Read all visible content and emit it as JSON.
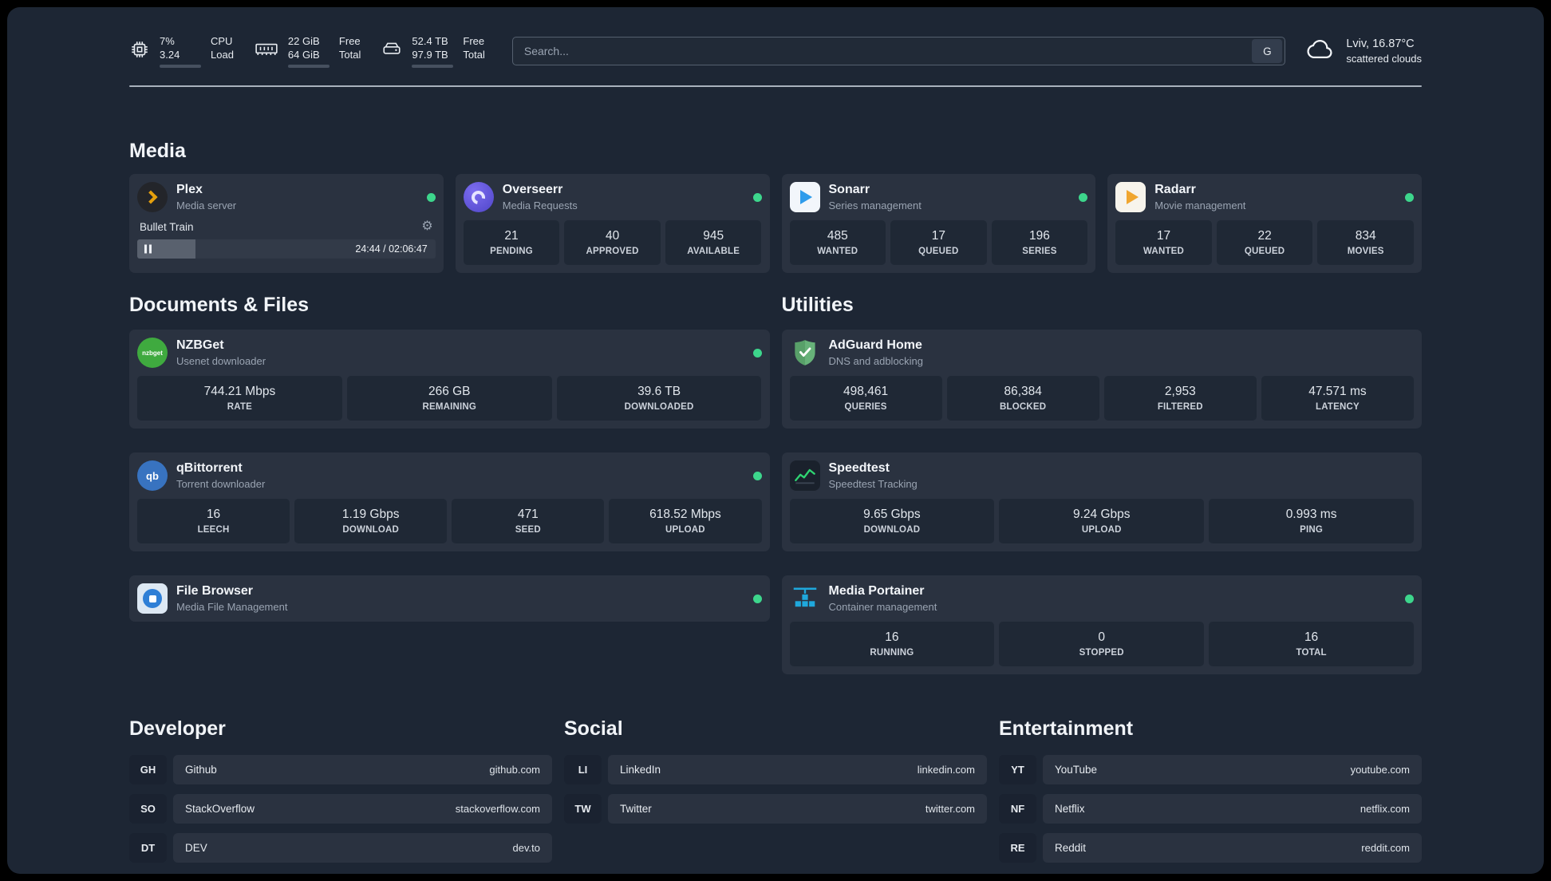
{
  "colors": {
    "panel_bg": "#1d2634",
    "card_bg": "#2a3240",
    "tile_bg": "#1f2835",
    "status_green": "#3dd68c",
    "plex_amber": "#e5a00d",
    "sonarr_blue": "#2f9ceb",
    "radarr_amber": "#f0a62f",
    "adguard_green": "#67b279",
    "portainer_blue": "#1fa8dc",
    "speedtest_green": "#2fd472"
  },
  "topbar": {
    "cpu": {
      "value_line1": "7%",
      "value_line2": "3.24",
      "bar_percent": 7,
      "label_line1": "CPU",
      "label_line2": "Load"
    },
    "memory": {
      "value_line1": "22 GiB",
      "value_line2": "64 GiB",
      "bar_percent": 34,
      "label_line1": "Free",
      "label_line2": "Total"
    },
    "disk": {
      "value_line1": "52.4 TB",
      "value_line2": "97.9 TB",
      "bar_percent": 54,
      "label_line1": "Free",
      "label_line2": "Total"
    },
    "search": {
      "placeholder": "Search...",
      "button_label": "G"
    },
    "weather": {
      "location": "Lviv, 16.87°C",
      "condition": "scattered clouds"
    }
  },
  "media": {
    "heading": "Media",
    "plex": {
      "name": "Plex",
      "subtitle": "Media server",
      "now_playing": "Bullet Train",
      "time": "24:44 / 02:06:47",
      "progress_percent": 19.5
    },
    "overseerr": {
      "name": "Overseerr",
      "subtitle": "Media Requests",
      "stats": [
        {
          "value": "21",
          "label": "PENDING"
        },
        {
          "value": "40",
          "label": "APPROVED"
        },
        {
          "value": "945",
          "label": "AVAILABLE"
        }
      ]
    },
    "sonarr": {
      "name": "Sonarr",
      "subtitle": "Series management",
      "stats": [
        {
          "value": "485",
          "label": "WANTED"
        },
        {
          "value": "17",
          "label": "QUEUED"
        },
        {
          "value": "196",
          "label": "SERIES"
        }
      ]
    },
    "radarr": {
      "name": "Radarr",
      "subtitle": "Movie management",
      "stats": [
        {
          "value": "17",
          "label": "WANTED"
        },
        {
          "value": "22",
          "label": "QUEUED"
        },
        {
          "value": "834",
          "label": "MOVIES"
        }
      ]
    }
  },
  "documents": {
    "heading": "Documents & Files",
    "nzbget": {
      "name": "NZBGet",
      "subtitle": "Usenet downloader",
      "icon_text": "nzbget",
      "stats": [
        {
          "value": "744.21 Mbps",
          "label": "RATE"
        },
        {
          "value": "266 GB",
          "label": "REMAINING"
        },
        {
          "value": "39.6 TB",
          "label": "DOWNLOADED"
        }
      ]
    },
    "qbittorrent": {
      "name": "qBittorrent",
      "subtitle": "Torrent downloader",
      "icon_text": "qb",
      "stats": [
        {
          "value": "16",
          "label": "LEECH"
        },
        {
          "value": "1.19 Gbps",
          "label": "DOWNLOAD"
        },
        {
          "value": "471",
          "label": "SEED"
        },
        {
          "value": "618.52 Mbps",
          "label": "UPLOAD"
        }
      ]
    },
    "filebrowser": {
      "name": "File Browser",
      "subtitle": "Media File Management"
    }
  },
  "utilities": {
    "heading": "Utilities",
    "adguard": {
      "name": "AdGuard Home",
      "subtitle": "DNS and adblocking",
      "stats": [
        {
          "value": "498,461",
          "label": "QUERIES"
        },
        {
          "value": "86,384",
          "label": "BLOCKED"
        },
        {
          "value": "2,953",
          "label": "FILTERED"
        },
        {
          "value": "47.571 ms",
          "label": "LATENCY"
        }
      ]
    },
    "speedtest": {
      "name": "Speedtest",
      "subtitle": "Speedtest Tracking",
      "stats": [
        {
          "value": "9.65 Gbps",
          "label": "DOWNLOAD"
        },
        {
          "value": "9.24 Gbps",
          "label": "UPLOAD"
        },
        {
          "value": "0.993 ms",
          "label": "PING"
        }
      ]
    },
    "portainer": {
      "name": "Media Portainer",
      "subtitle": "Container management",
      "stats": [
        {
          "value": "16",
          "label": "RUNNING"
        },
        {
          "value": "0",
          "label": "STOPPED"
        },
        {
          "value": "16",
          "label": "TOTAL"
        }
      ]
    }
  },
  "bookmarks": {
    "developer": {
      "heading": "Developer",
      "items": [
        {
          "abbr": "GH",
          "name": "Github",
          "domain": "github.com"
        },
        {
          "abbr": "SO",
          "name": "StackOverflow",
          "domain": "stackoverflow.com"
        },
        {
          "abbr": "DT",
          "name": "DEV",
          "domain": "dev.to"
        }
      ]
    },
    "social": {
      "heading": "Social",
      "items": [
        {
          "abbr": "LI",
          "name": "LinkedIn",
          "domain": "linkedin.com"
        },
        {
          "abbr": "TW",
          "name": "Twitter",
          "domain": "twitter.com"
        }
      ]
    },
    "entertainment": {
      "heading": "Entertainment",
      "items": [
        {
          "abbr": "YT",
          "name": "YouTube",
          "domain": "youtube.com"
        },
        {
          "abbr": "NF",
          "name": "Netflix",
          "domain": "netflix.com"
        },
        {
          "abbr": "RE",
          "name": "Reddit",
          "domain": "reddit.com"
        }
      ]
    }
  }
}
